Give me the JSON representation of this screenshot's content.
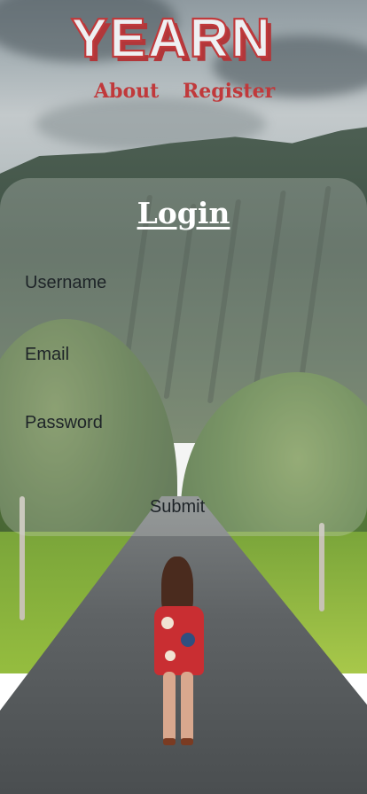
{
  "header": {
    "logo_text": "YEARN",
    "nav": [
      {
        "label": "About"
      },
      {
        "label": "Register"
      }
    ]
  },
  "login": {
    "title": "Login",
    "fields": [
      {
        "label": "Username"
      },
      {
        "label": "Email"
      },
      {
        "label": "Password"
      }
    ],
    "submit_label": "Submit"
  },
  "colors": {
    "brand_red": "#c0393b",
    "panel_tint": "rgba(214,220,214,0.28)",
    "label_text": "#1e2428"
  }
}
